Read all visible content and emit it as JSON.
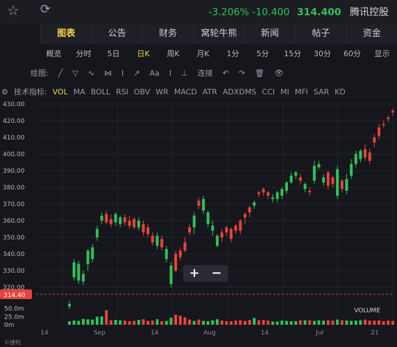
{
  "header": {
    "name": "腾讯控股",
    "price": "314.400",
    "change": "-10.400",
    "change_pct": "-3.206%",
    "favorite_icon": "star-icon",
    "refresh_icon": "refresh-icon"
  },
  "tabs": [
    "图表",
    "公告",
    "财务",
    "窝轮牛熊",
    "新闻",
    "帖子",
    "资金"
  ],
  "active_tab": 0,
  "periods": [
    "概览",
    "分时",
    "5日",
    "日K",
    "周K",
    "月K",
    "1分",
    "5分",
    "15分",
    "30分",
    "60分",
    "显示"
  ],
  "active_period": 3,
  "drawing_tools": [
    "绘图:",
    "╱",
    "▽",
    "∿",
    "⋈",
    "I",
    "↗",
    "Aa",
    "I",
    "⊥",
    "连接",
    "↶",
    "↷",
    "🗑",
    "👁"
  ],
  "indicators": {
    "label": "技术指标:",
    "items": [
      "VOL",
      "MA",
      "BOLL",
      "RSI",
      "OBV",
      "WR",
      "MACD",
      "ATR",
      "ADXDMS",
      "CCI",
      "MI",
      "MFI",
      "SAR",
      "KD"
    ],
    "active": 0
  },
  "zoom": {
    "plus": "+",
    "minus": "−"
  },
  "volume_label": "VOLUME",
  "footer_label": "©捷利",
  "colors": {
    "up": "#e8433f",
    "down": "#2fc25b",
    "current": "#e8433f",
    "bg": "#16171c",
    "accent": "#f0d34a"
  },
  "chart_data": {
    "type": "candlestick",
    "price_axis": {
      "min": 320,
      "max": 430,
      "ticks": [
        "320.00",
        "330.00",
        "340.00",
        "350.00",
        "360.00",
        "370.00",
        "380.00",
        "390.00",
        "400.00",
        "410.00",
        "420.00",
        "430.00"
      ]
    },
    "current_price": "314.40",
    "volume_axis": {
      "max": 60,
      "unit": "m",
      "ticks": [
        "0m",
        "25.0m",
        "50.0m"
      ]
    },
    "x_labels": [
      "14",
      "Sep",
      "14",
      "Aug",
      "14",
      "Jul",
      "21"
    ],
    "candles": [
      [
        310,
        308.5,
        312,
        307,
        11
      ],
      [
        335,
        326,
        337,
        324,
        13
      ],
      [
        334,
        324,
        336,
        322,
        12
      ],
      [
        328,
        323.5,
        330,
        321.5,
        18
      ],
      [
        342,
        334,
        343,
        330,
        17
      ],
      [
        344,
        337,
        346,
        335,
        16
      ],
      [
        355,
        350,
        357,
        348,
        25
      ],
      [
        363,
        360,
        365,
        358,
        26
      ],
      [
        359,
        364,
        366,
        358,
        45
      ],
      [
        358,
        361,
        364,
        356,
        14
      ],
      [
        364,
        359,
        365,
        357,
        15
      ],
      [
        362,
        358,
        363,
        356,
        14
      ],
      [
        359,
        362,
        364,
        357,
        13
      ],
      [
        357,
        360,
        363,
        355,
        11
      ],
      [
        356,
        361,
        362,
        355,
        12
      ],
      [
        360,
        356,
        362,
        354,
        15
      ],
      [
        353,
        358,
        360,
        351,
        17
      ],
      [
        352,
        356,
        358,
        350,
        12
      ],
      [
        347,
        351,
        353,
        345,
        13
      ],
      [
        351,
        345,
        353,
        343,
        17
      ],
      [
        344,
        349,
        351,
        342,
        11
      ],
      [
        343,
        337,
        345,
        335,
        12
      ],
      [
        333,
        322,
        335,
        320,
        22
      ],
      [
        330,
        340,
        342,
        329,
        31
      ],
      [
        338,
        342,
        344,
        336,
        28
      ],
      [
        342,
        347,
        350,
        341,
        23
      ],
      [
        353,
        356,
        358,
        351,
        16
      ],
      [
        363,
        356,
        365,
        352,
        12
      ],
      [
        369,
        372,
        374,
        367,
        16
      ],
      [
        373,
        366,
        375,
        364,
        12
      ],
      [
        365,
        358,
        366,
        356,
        11
      ],
      [
        357,
        354,
        360,
        351,
        14
      ],
      [
        351,
        345,
        352,
        344,
        17
      ],
      [
        350,
        353,
        355,
        347,
        13
      ],
      [
        353,
        356,
        357,
        351,
        11
      ],
      [
        349,
        355,
        356,
        347,
        11
      ],
      [
        354,
        357,
        358,
        352,
        13
      ],
      [
        354,
        360,
        361,
        352,
        14
      ],
      [
        362,
        364,
        365,
        358,
        12
      ],
      [
        365,
        368,
        369,
        362,
        15
      ],
      [
        371,
        369,
        372,
        367,
        21
      ],
      [
        376,
        377,
        378,
        374,
        14
      ],
      [
        377,
        379,
        380,
        375,
        15
      ],
      [
        375,
        377,
        378,
        373,
        13
      ],
      [
        374,
        373,
        376,
        371,
        10
      ],
      [
        377,
        373,
        378,
        371,
        10
      ],
      [
        379,
        375,
        380,
        373,
        13
      ],
      [
        383,
        378,
        384,
        376,
        12
      ],
      [
        387,
        383,
        389,
        382,
        11
      ],
      [
        389,
        387,
        390,
        385,
        11
      ],
      [
        384,
        386,
        388,
        382,
        14
      ],
      [
        382,
        379,
        383,
        377,
        14
      ],
      [
        377,
        378,
        380,
        375,
        14
      ],
      [
        393,
        384,
        396,
        382,
        12
      ],
      [
        394,
        392,
        396,
        391,
        14
      ],
      [
        386,
        383,
        388,
        381,
        13
      ],
      [
        381,
        389,
        390,
        379,
        14
      ],
      [
        382,
        386,
        387,
        380,
        13
      ],
      [
        391,
        375,
        393,
        373,
        16
      ],
      [
        379,
        384,
        385,
        377,
        14
      ],
      [
        385,
        378,
        388,
        376,
        13
      ],
      [
        394,
        387,
        397,
        385,
        12
      ],
      [
        400,
        394,
        402,
        392,
        13
      ],
      [
        402,
        397,
        403,
        395,
        14
      ],
      [
        398,
        403,
        406,
        396,
        16
      ],
      [
        396,
        401,
        403,
        394,
        13
      ],
      [
        407,
        410,
        412,
        404,
        13
      ],
      [
        411,
        416,
        418,
        409,
        14
      ],
      [
        418,
        418,
        420,
        416,
        11
      ],
      [
        421,
        422,
        423,
        419,
        13
      ],
      [
        425,
        426,
        427,
        423,
        12
      ]
    ]
  }
}
